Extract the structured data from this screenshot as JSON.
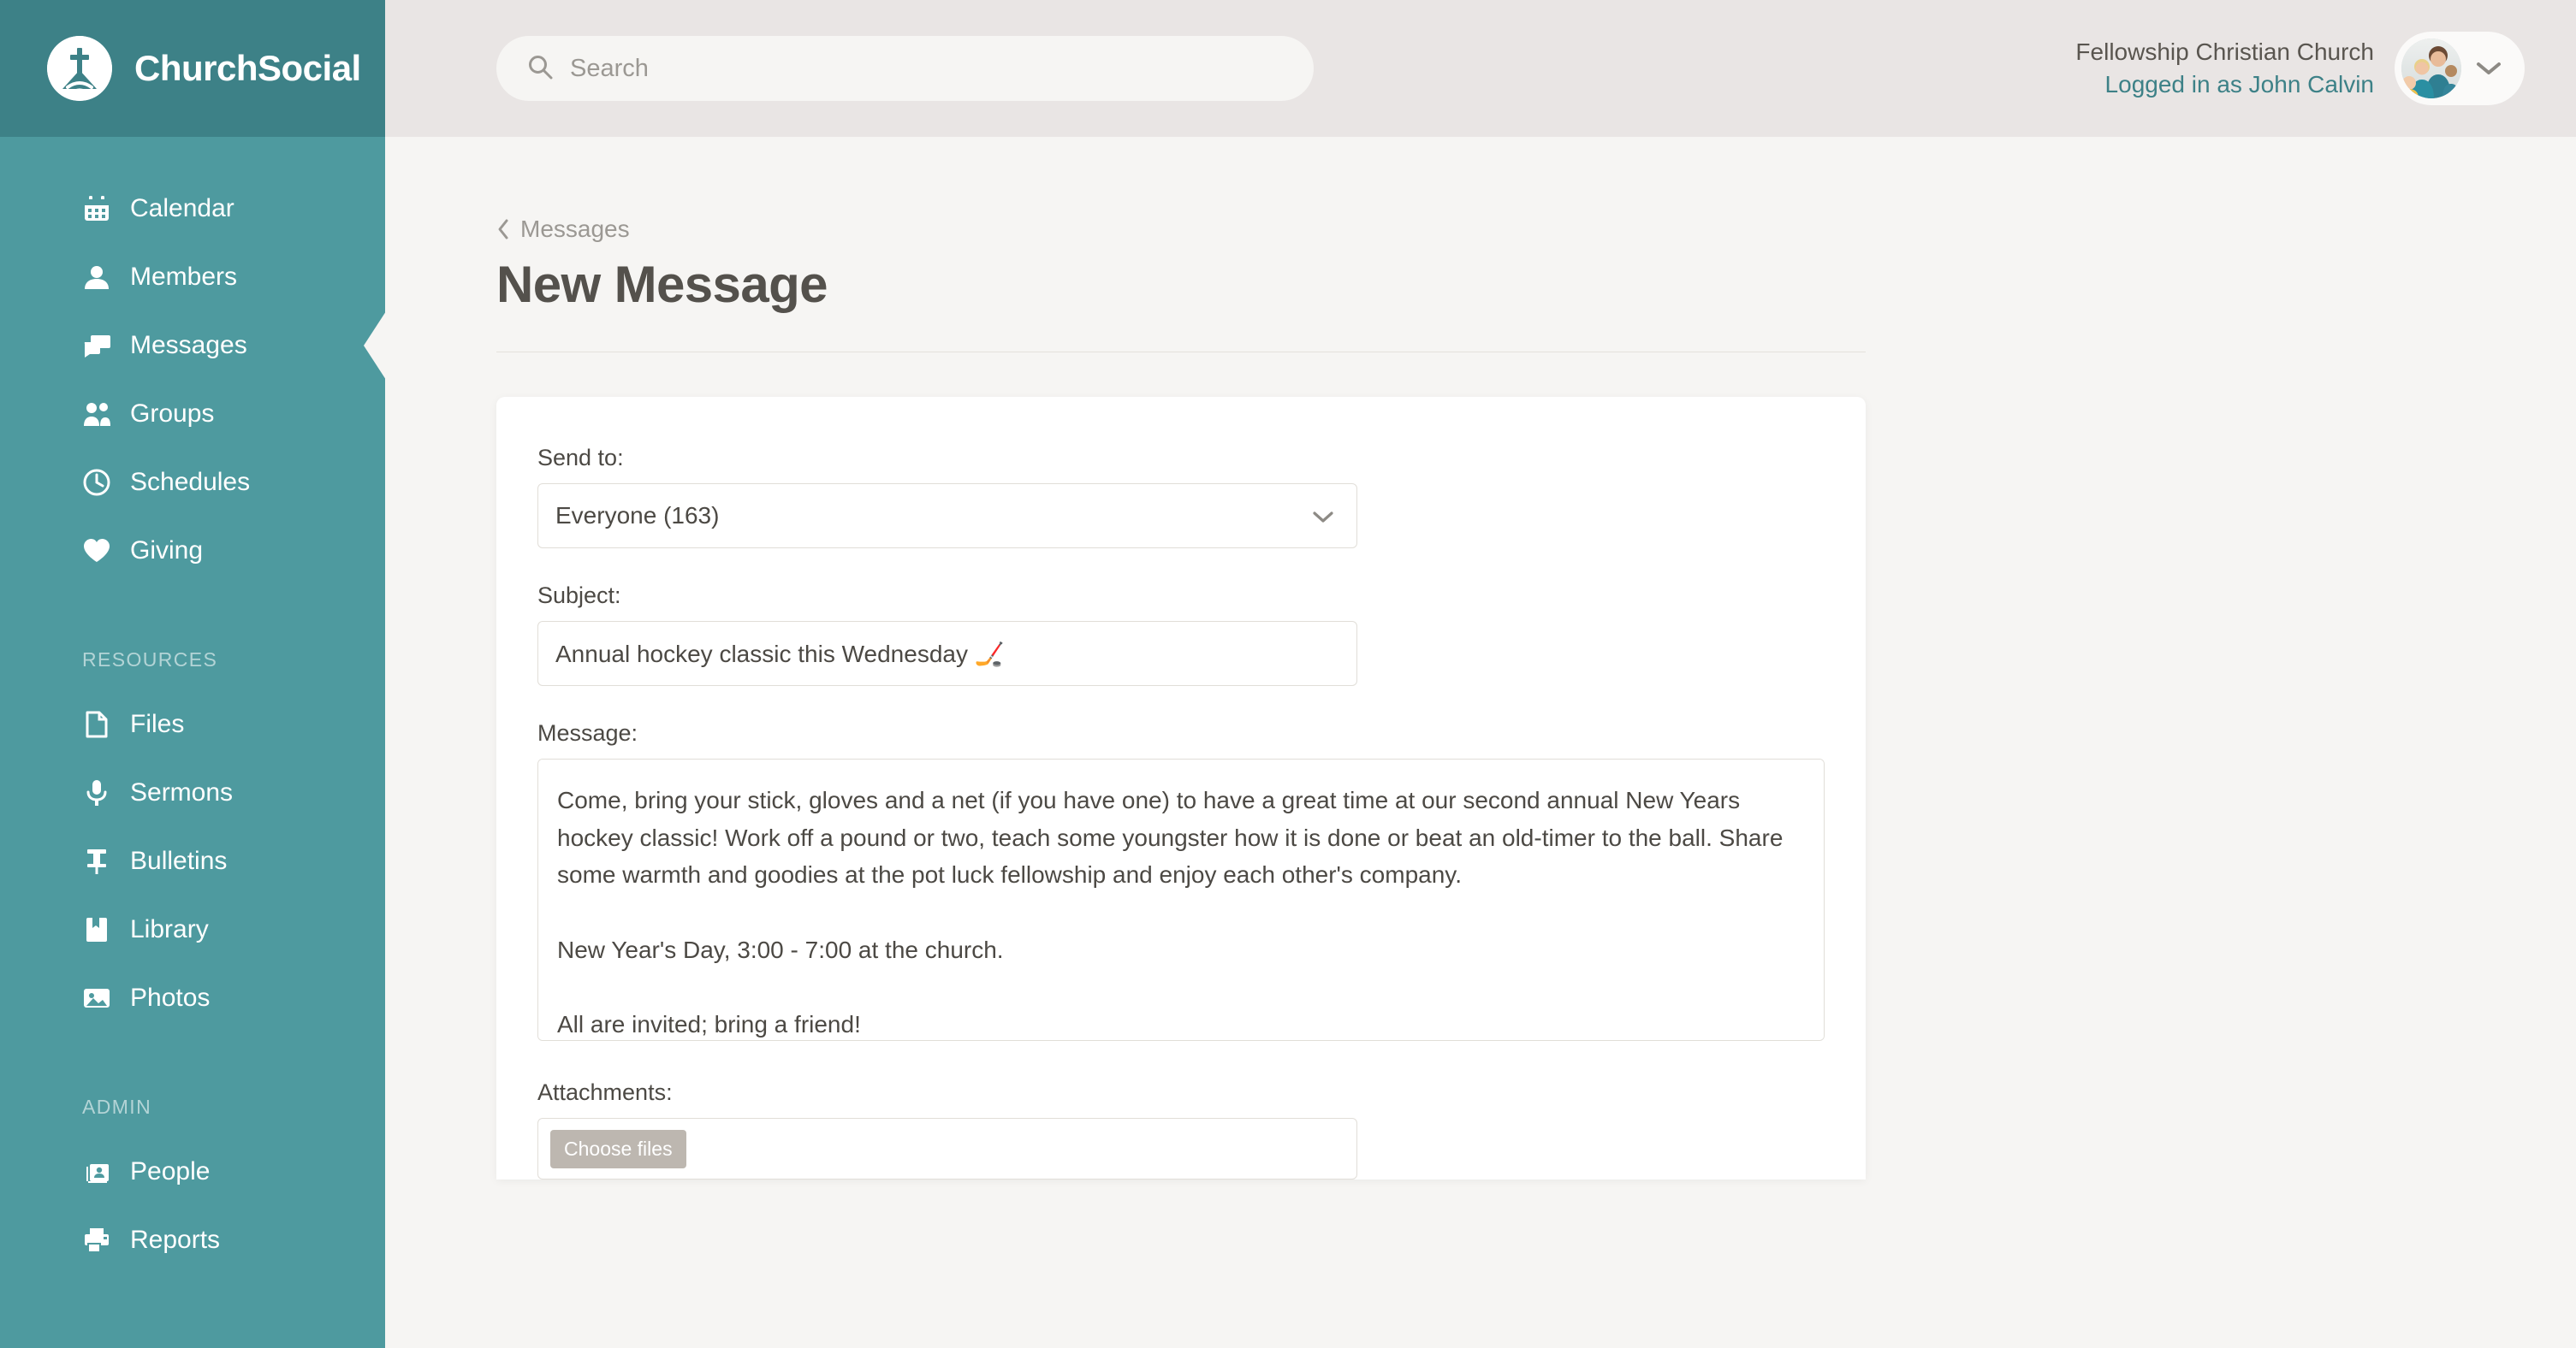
{
  "brand": {
    "name": "ChurchSocial",
    "logo_icon": "church-cross-logo-icon",
    "teal": "#4e9a9f",
    "teal_dark": "#3d8187"
  },
  "topbar": {
    "search": {
      "placeholder": "Search",
      "value": "",
      "icon": "search-icon"
    },
    "user": {
      "church": "Fellowship Christian Church",
      "logged_in": "Logged in as John Calvin",
      "avatar_icon": "avatar",
      "chevron_icon": "chevron-down-icon"
    }
  },
  "sidebar": {
    "primary": [
      {
        "label": "Calendar",
        "icon": "calendar-icon",
        "active": false
      },
      {
        "label": "Members",
        "icon": "person-icon",
        "active": false
      },
      {
        "label": "Messages",
        "icon": "chat-bubbles-icon",
        "active": true
      },
      {
        "label": "Groups",
        "icon": "group-icon",
        "active": false
      },
      {
        "label": "Schedules",
        "icon": "clock-icon",
        "active": false
      },
      {
        "label": "Giving",
        "icon": "heart-icon",
        "active": false
      }
    ],
    "sections": [
      {
        "title": "RESOURCES",
        "items": [
          {
            "label": "Files",
            "icon": "file-icon"
          },
          {
            "label": "Sermons",
            "icon": "microphone-icon"
          },
          {
            "label": "Bulletins",
            "icon": "pushpin-icon"
          },
          {
            "label": "Library",
            "icon": "book-icon"
          },
          {
            "label": "Photos",
            "icon": "image-icon"
          }
        ]
      },
      {
        "title": "ADMIN",
        "items": [
          {
            "label": "People",
            "icon": "id-card-icon"
          },
          {
            "label": "Reports",
            "icon": "printer-icon"
          }
        ]
      }
    ]
  },
  "page": {
    "breadcrumb": {
      "label": "Messages",
      "icon": "chevron-left-icon"
    },
    "title": "New Message"
  },
  "form": {
    "send_to": {
      "label": "Send to:",
      "value": "Everyone (163)",
      "chevron_icon": "chevron-down-icon"
    },
    "subject": {
      "label": "Subject:",
      "value": "Annual hockey classic this Wednesday 🏒",
      "placeholder": ""
    },
    "message": {
      "label": "Message:",
      "value": "Come, bring your stick, gloves and a net (if you have one) to have a great time at our second annual New Years hockey classic! Work off a pound or two, teach some youngster how it is done or beat an old-timer to the ball. Share some warmth and goodies at the pot luck fellowship and enjoy each other's company.\n\nNew Year's Day, 3:00 - 7:00 at the church.\n\nAll are invited; bring a friend!",
      "placeholder": ""
    },
    "attachments": {
      "label": "Attachments:",
      "button_label": "Choose files"
    }
  }
}
